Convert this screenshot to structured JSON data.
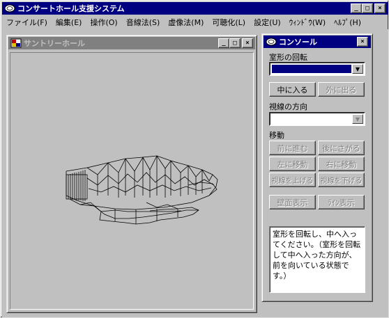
{
  "app": {
    "title": "コンサートホール支援システム",
    "controls": {
      "minimize": "_",
      "maximize": "□",
      "close": "×"
    }
  },
  "menu": [
    "ファイル(F)",
    "編集(E)",
    "操作(O)",
    "音線法(S)",
    "虚像法(M)",
    "可聴化(L)",
    "設定(U)",
    "ｳｨﾝﾄﾞｳ(W)",
    "ﾍﾙﾌﾟ(H)"
  ],
  "hall_window": {
    "title": "サントリーホール",
    "controls": {
      "minimize": "_",
      "maximize": "□",
      "close": "×"
    }
  },
  "console": {
    "title": "コンソール",
    "close": "×",
    "rotate_label": "室形の回転",
    "rotate_value": "",
    "enter_button": "中に入る",
    "exit_button": "外に出る",
    "direction_label": "視線の方向",
    "direction_value": "",
    "move_label": "移動",
    "forward_button": "前に進む",
    "back_button": "後にさがる",
    "left_button": "左に移動",
    "right_button": "右に移動",
    "look_up_button": "視線を上げる",
    "look_down_button": "視線を下げる",
    "wall_button": "壁面表示",
    "line_button": "ﾗｲﾝ表示",
    "message": "室形を回転し、中へ入ってください。（室形を回転して中へ入った方向が、前を向いている状態です。）"
  },
  "colors": {
    "active_title": "#000080",
    "inactive_title": "#808080",
    "face": "#c0c0c0",
    "wireframe": "#000000"
  }
}
